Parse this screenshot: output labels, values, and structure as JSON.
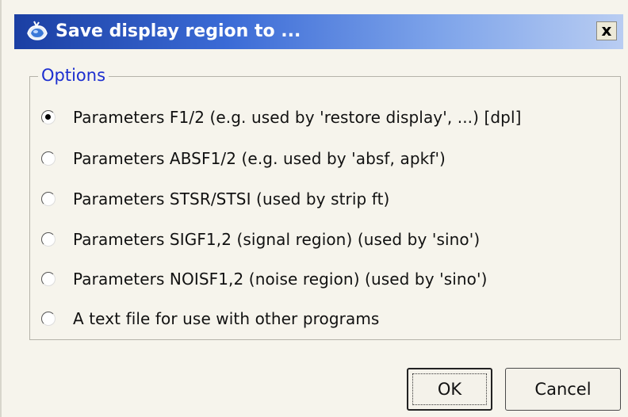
{
  "dialog": {
    "title": "Save display region to ...",
    "close_label": "x",
    "title_icon": "app-icon"
  },
  "options_group": {
    "legend": "Options",
    "selected_index": 0,
    "items": [
      {
        "label": "Parameters F1/2 (e.g. used by 'restore display', ...) [dpl]",
        "checked": true
      },
      {
        "label": "Parameters ABSF1/2 (e.g. used by 'absf, apkf')",
        "checked": false
      },
      {
        "label": "Parameters STSR/STSI (used by strip ft)",
        "checked": false
      },
      {
        "label": "Parameters SIGF1,2 (signal region) (used by 'sino')",
        "checked": false
      },
      {
        "label": "Parameters NOISF1,2 (noise region) (used by 'sino')",
        "checked": false
      },
      {
        "label": "A text file for use with other programs",
        "checked": false
      }
    ]
  },
  "buttons": {
    "ok_label": "OK",
    "cancel_label": "Cancel"
  },
  "colors": {
    "title_start": "#1b3fa3",
    "title_end": "#b9cdf2",
    "legend_text": "#1d2fd0",
    "dialog_bg": "#f6f4ec"
  }
}
